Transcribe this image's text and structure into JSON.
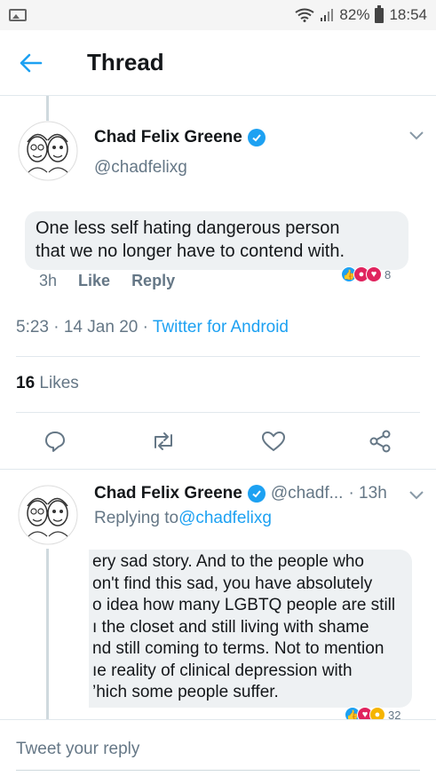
{
  "status_bar": {
    "battery": "82%",
    "time": "18:54"
  },
  "header": {
    "title": "Thread"
  },
  "main_tweet": {
    "name": "Chad Felix Greene",
    "handle": "@chadfelixg",
    "text_lines": [
      "One less self hating dangerous person",
      "that we no longer have to contend with."
    ],
    "age": "3h",
    "like_label": "Like",
    "reply_label": "Reply",
    "reaction_count": "8"
  },
  "timestamp": {
    "time_date": "5:23 · 14 Jan 20 · ",
    "client": "Twitter for Android"
  },
  "likes": {
    "count": "16",
    "label": " Likes"
  },
  "reply_tweet": {
    "name": "Chad Felix Greene",
    "handle": "@chadf...",
    "age": "· 13h",
    "replying_prefix": "Replying to ",
    "replying_to": "@chadfelixg",
    "text_lines": [
      "ery sad story. And to the people who",
      "on't find this sad, you have absolutely",
      "o idea how many LGBTQ people are still",
      "ı the closet and still living with shame",
      "nd still coming to terms. Not to mention",
      "ıe reality of clinical depression with",
      "’hich some people suffer."
    ],
    "reaction_count": "32"
  },
  "reply_bar": {
    "placeholder": "Tweet your reply"
  },
  "colors": {
    "accent": "#1da1f2",
    "secondary_text": "#657786",
    "divider": "#e1e8ed"
  },
  "icons": [
    "back-arrow-icon",
    "verified-icon",
    "chevron-down-icon",
    "reply-icon",
    "retweet-icon",
    "like-icon",
    "share-icon"
  ]
}
